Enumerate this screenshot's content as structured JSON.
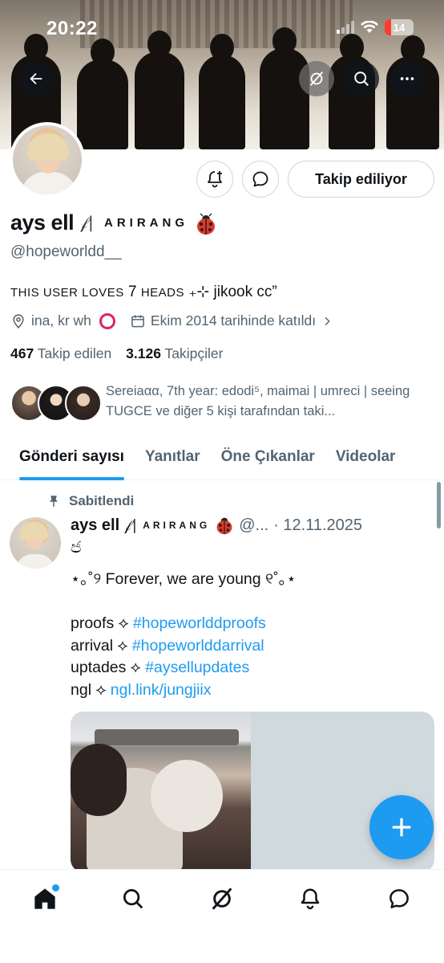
{
  "status_bar": {
    "time": "20:22",
    "battery": "14"
  },
  "profile": {
    "name": "ays ell",
    "name_fancy": "𝒻∣",
    "name_tag": "ARIRANG",
    "handle": "@hopeworldd__",
    "bio_caps": "THIS USER LOVES",
    "bio_num": "7",
    "bio_caps2": "HEADS",
    "bio_rest": "₊⊹ jikook cc”",
    "location": "ina, kr wh",
    "joined": "Ekim 2014 tarihinde katıldı",
    "following_count": "467",
    "following_label": "Takip edilen",
    "followers_count": "3.126",
    "followers_label": "Takipçiler",
    "known_followers_text": "Sereiaαα, 7th year: edodi⁵, maimai | umreci | seeing TUGCE ve diğer 5 kişi tarafından taki..."
  },
  "actions": {
    "follow_label": "Takip ediliyor"
  },
  "tabs": [
    {
      "label": "Gönderi sayısı",
      "active": true
    },
    {
      "label": "Yanıtlar",
      "active": false
    },
    {
      "label": "Öne Çıkanlar",
      "active": false
    },
    {
      "label": "Videolar",
      "active": false
    }
  ],
  "post": {
    "pinned_label": "Sabitlendi",
    "author": "ays ell",
    "author_fancy": "𝒻∣",
    "author_tag": "ARIRANG",
    "handle_truncated": "@...",
    "date": "· 12.11.2025",
    "sub_glyph": "ජ",
    "line1": "⋆｡˚୨ Forever, we are young ୧˚｡⋆",
    "lines": [
      {
        "label": "proofs ⟡ ",
        "tag": "#hopeworlddproofs"
      },
      {
        "label": "arrival ⟡ ",
        "tag": "#hopeworlddarrival"
      },
      {
        "label": "uptades ⟡ ",
        "tag": "#aysellupdates"
      },
      {
        "label": "ngl ⟡ ",
        "tag": "ngl.link/jungjiix"
      }
    ]
  },
  "colors": {
    "accent": "#1d9bf0",
    "text": "#0f1419",
    "muted": "#536471"
  },
  "icons": [
    "back-arrow-icon",
    "grok-icon",
    "search-icon",
    "more-icon",
    "bell-plus-icon",
    "message-icon",
    "location-icon",
    "calendar-icon",
    "chevron-right-icon",
    "pin-icon",
    "compose-plus-icon",
    "home-icon",
    "explore-icon",
    "grok-nav-icon",
    "notifications-icon",
    "chat-icon"
  ]
}
